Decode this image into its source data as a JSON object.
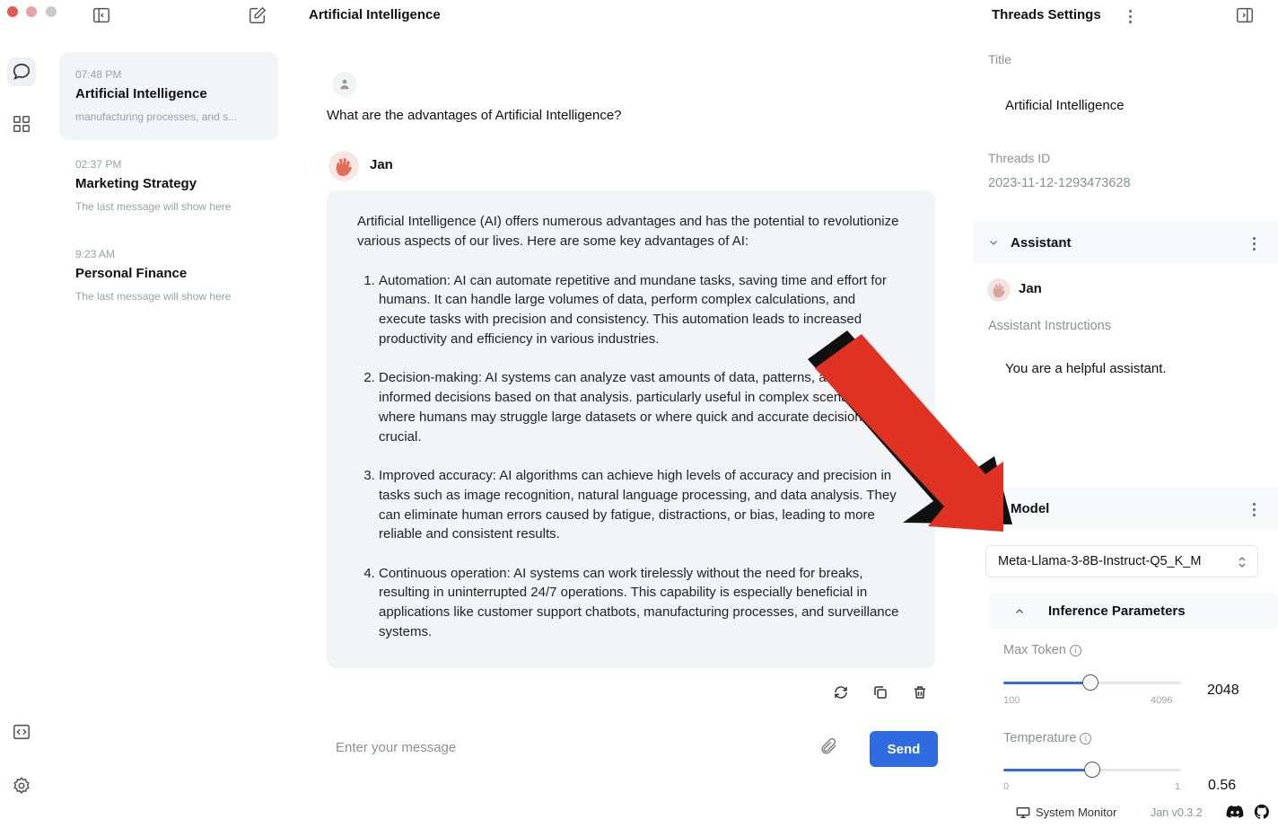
{
  "window": {
    "traffic_colors": [
      "#e25a52",
      "#e7a1a1",
      "#c8c8c8"
    ]
  },
  "threads": [
    {
      "time": "07:48 PM",
      "title": "Artificial Intelligence",
      "preview": "manufacturing processes, and s...",
      "active": true
    },
    {
      "time": "02:37 PM",
      "title": "Marketing Strategy",
      "preview": "The last message will show here",
      "active": false
    },
    {
      "time": "9:23 AM",
      "title": "Personal Finance",
      "preview": "The last message will show here",
      "active": false
    }
  ],
  "chat": {
    "title": "Artificial Intelligence",
    "user_message": "What are the advantages of Artificial Intelligence?",
    "assistant_name": "Jan",
    "answer_intro": "Artificial Intelligence (AI) offers numerous advantages and has the potential to revolutionize various aspects of our lives. Here are some key advantages of AI:",
    "answer_points": [
      "Automation: AI can automate repetitive and mundane tasks, saving time and effort for humans. It can handle large volumes of data, perform complex calculations, and execute tasks with precision and consistency. This automation leads to increased productivity and efficiency in various industries.",
      "Decision-making: AI systems can analyze vast amounts of data, patterns, and make informed decisions based on that analysis. particularly useful in complex scenarios where humans may struggle large datasets or where quick and accurate decisions are crucial.",
      "Improved accuracy: AI algorithms can achieve high levels of accuracy and precision in tasks such as image recognition, natural language processing, and data analysis. They can eliminate human errors caused by fatigue, distractions, or bias, leading to more reliable and consistent results.",
      "Continuous operation: AI systems can work tirelessly without the need for breaks, resulting in uninterrupted 24/7 operations. This capability is especially beneficial in applications like customer support chatbots, manufacturing processes, and surveillance systems."
    ],
    "input_placeholder": "Enter your message",
    "send_label": "Send"
  },
  "settings": {
    "header": "Threads Settings",
    "title_label": "Title",
    "title_value": "Artificial Intelligence",
    "thread_id_label": "Threads ID",
    "thread_id_value": "2023-11-12-1293473628",
    "assistant_section": "Assistant",
    "assistant_name": "Jan",
    "instructions_label": "Assistant Instructions",
    "instructions_value": "You are a helpful assistant.",
    "model_section": "Model",
    "model_value": "Meta-Llama-3-8B-Instruct-Q5_K_M",
    "inference_section": "Inference Parameters",
    "max_token": {
      "label": "Max Token",
      "min": "100",
      "max": "4096",
      "value": "2048",
      "fraction": 0.49
    },
    "temperature": {
      "label": "Temperature",
      "min": "0",
      "max": "1",
      "value": "0.56",
      "fraction": 0.5
    }
  },
  "footer": {
    "system_monitor": "System Monitor",
    "version": "Jan v0.3.2"
  },
  "colors": {
    "accent": "#2f6be0",
    "arrow": "#e03222"
  }
}
